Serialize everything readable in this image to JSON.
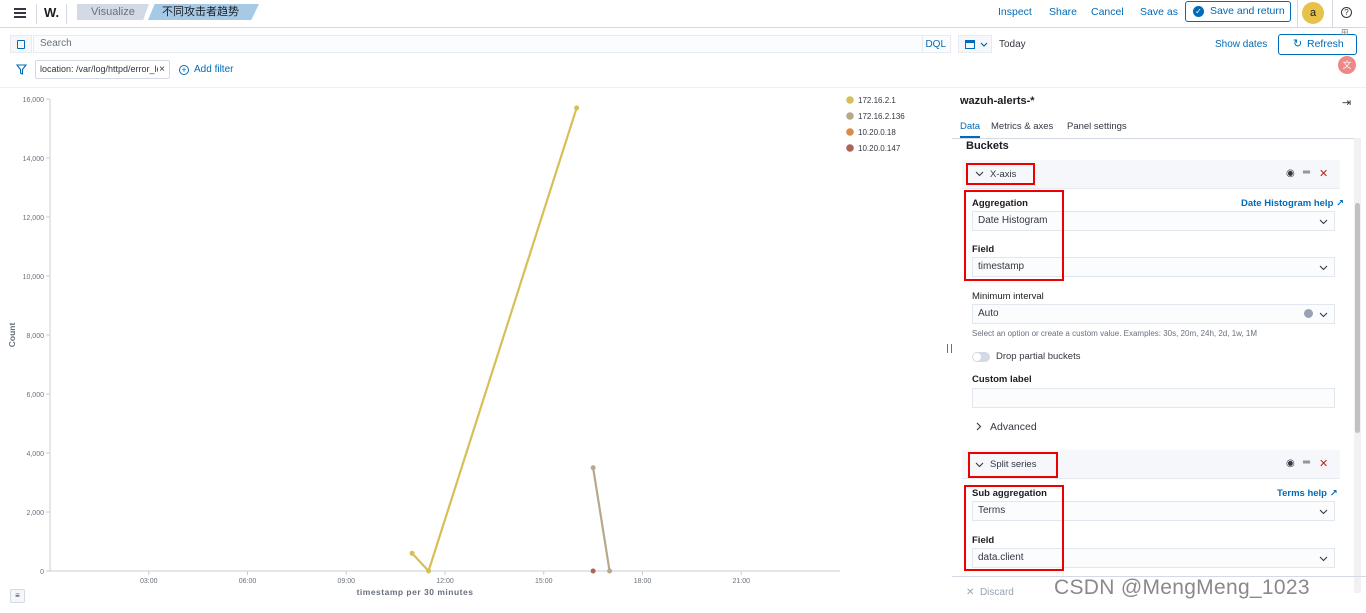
{
  "header": {
    "app_logo": "W.",
    "breadcrumbs": [
      "Visualize",
      "不同攻击者趋势对比"
    ],
    "actions": [
      "Inspect",
      "Share",
      "Cancel",
      "Save as"
    ],
    "save_return_label": "Save and return",
    "avatar_letter": "a",
    "help_icon": "?"
  },
  "query": {
    "search_placeholder": "Search",
    "language": "DQL",
    "date": "Today",
    "show_dates": "Show dates",
    "refresh": "Refresh",
    "filter_pill": "location: /var/log/httpd/error_log",
    "add_filter": "Add filter"
  },
  "chart_data": {
    "type": "line",
    "xlabel": "timestamp per 30 minutes",
    "ylabel": "Count",
    "x_ticks": [
      "03:00",
      "06:00",
      "09:00",
      "12:00",
      "15:00",
      "18:00",
      "21:00"
    ],
    "y_ticks": [
      "0",
      "2,000",
      "4,000",
      "6,000",
      "8,000",
      "10,000",
      "12,000",
      "14,000",
      "16,000"
    ],
    "ylim": [
      0,
      16000
    ],
    "x_range_hours": [
      0,
      24
    ],
    "legend_position": "top-right",
    "series": [
      {
        "name": "172.16.2.1",
        "color": "#d6bf57",
        "points": [
          {
            "x": "11:00",
            "y": 600
          },
          {
            "x": "11:30",
            "y": 0
          },
          {
            "x": "16:00",
            "y": 15700
          }
        ]
      },
      {
        "name": "172.16.2.136",
        "color": "#b9a888",
        "points": [
          {
            "x": "16:30",
            "y": 3500
          },
          {
            "x": "17:00",
            "y": 0
          }
        ]
      },
      {
        "name": "10.20.0.18",
        "color": "#da8b45",
        "points": []
      },
      {
        "name": "10.20.0.147",
        "color": "#aa6556",
        "points": [
          {
            "x": "16:30",
            "y": 0
          }
        ]
      }
    ]
  },
  "panel": {
    "index_pattern": "wazuh-alerts-*",
    "tabs": [
      "Data",
      "Metrics & axes",
      "Panel settings"
    ],
    "buckets_title": "Buckets",
    "xaxis": {
      "title": "X-axis",
      "aggregation_label": "Aggregation",
      "aggregation_help": "Date Histogram help",
      "aggregation_value": "Date Histogram",
      "field_label": "Field",
      "field_value": "timestamp",
      "min_interval_label": "Minimum interval",
      "min_interval_value": "Auto",
      "interval_help": "Select an option or create a custom value. Examples: 30s, 20m, 24h, 2d, 1w, 1M",
      "drop_partial": "Drop partial buckets",
      "custom_label": "Custom label",
      "advanced": "Advanced"
    },
    "split": {
      "title": "Split series",
      "sub_agg_label": "Sub aggregation",
      "terms_help": "Terms help",
      "sub_agg_value": "Terms",
      "field_label": "Field",
      "field_value": "data.client"
    },
    "discard": "Discard"
  },
  "watermark": "CSDN @MengMeng_1023"
}
